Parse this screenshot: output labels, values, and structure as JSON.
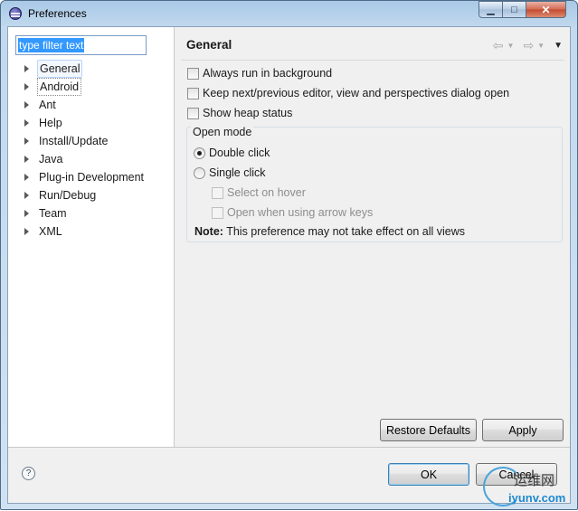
{
  "window": {
    "title": "Preferences",
    "minimize_glyph": "▁",
    "maximize_glyph": "□",
    "close_glyph": "✕"
  },
  "filter": {
    "value": "type filter text"
  },
  "tree": {
    "items": [
      {
        "label": "General",
        "selected": true
      },
      {
        "label": "Android",
        "focused": true
      },
      {
        "label": "Ant"
      },
      {
        "label": "Help"
      },
      {
        "label": "Install/Update"
      },
      {
        "label": "Java"
      },
      {
        "label": "Plug-in Development"
      },
      {
        "label": "Run/Debug"
      },
      {
        "label": "Team"
      },
      {
        "label": "XML"
      }
    ]
  },
  "page": {
    "title": "General",
    "options": {
      "always_run": {
        "label": "Always run in background",
        "checked": false
      },
      "keep_next": {
        "label": "Keep next/previous editor, view and perspectives dialog open",
        "checked": false
      },
      "show_heap": {
        "label": "Show heap status",
        "checked": false
      }
    },
    "open_mode": {
      "legend": "Open mode",
      "double_click": {
        "label": "Double click",
        "checked": true
      },
      "single_click": {
        "label": "Single click",
        "checked": false
      },
      "select_on_hover": {
        "label": "Select on hover",
        "enabled": false
      },
      "open_arrow_keys": {
        "label": "Open when using arrow keys",
        "enabled": false
      },
      "note_label": "Note:",
      "note_text": " This preference may not take effect on all views"
    },
    "restore_defaults": "Restore Defaults",
    "apply": "Apply"
  },
  "footer": {
    "ok": "OK",
    "cancel": "Cancel",
    "help_glyph": "?"
  },
  "watermark": {
    "cn": "运维网",
    "en": "iyunv.com"
  },
  "icons": {
    "back": "⇦",
    "forward": "⇨",
    "dropdown": "▼",
    "view_menu": "▼"
  }
}
